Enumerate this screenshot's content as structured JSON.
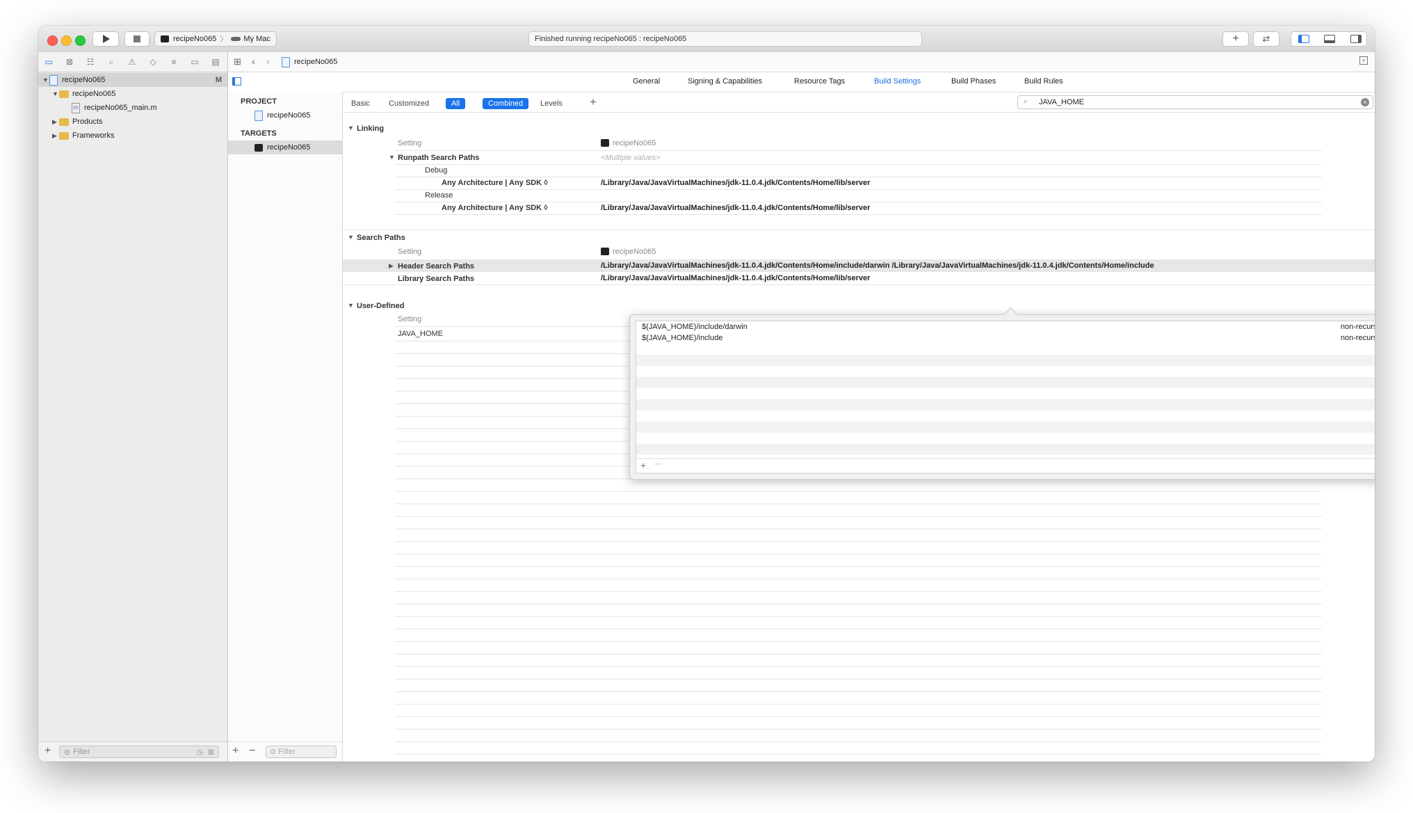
{
  "window": {
    "scheme_target": "recipeNo065",
    "destination": "My Mac",
    "status": "Finished running recipeNo065 : recipeNo065"
  },
  "navigator": {
    "badge": "M",
    "items": [
      {
        "label": "recipeNo065",
        "type": "project"
      },
      {
        "label": "recipeNo065",
        "type": "folder"
      },
      {
        "label": "recipeNo065_main.m",
        "type": "file"
      },
      {
        "label": "Products",
        "type": "folder"
      },
      {
        "label": "Frameworks",
        "type": "folder"
      }
    ],
    "filter_placeholder": "Filter"
  },
  "jumpbar": {
    "crumb": "recipeNo065"
  },
  "tabs": [
    "General",
    "Signing & Capabilities",
    "Resource Tags",
    "Build Settings",
    "Build Phases",
    "Build Rules"
  ],
  "active_tab": "Build Settings",
  "targets_pane": {
    "project_header": "PROJECT",
    "project_item": "recipeNo065",
    "targets_header": "TARGETS",
    "target_item": "recipeNo065",
    "filter_placeholder": "Filter"
  },
  "filterbar": {
    "basic": "Basic",
    "customized": "Customized",
    "all": "All",
    "combined": "Combined",
    "levels": "Levels",
    "search_value": "JAVA_HOME"
  },
  "sections": {
    "linking": {
      "title": "Linking",
      "setting_col": "Setting",
      "target_col": "recipeNo065",
      "runpath_label": "Runpath Search Paths",
      "runpath_value": "<Multiple values>",
      "debug_label": "Debug",
      "debug_arch": "Any Architecture | Any SDK ◊",
      "debug_value": "/Library/Java/JavaVirtualMachines/jdk-11.0.4.jdk/Contents/Home/lib/server",
      "release_label": "Release",
      "release_arch": "Any Architecture | Any SDK ◊",
      "release_value": "/Library/Java/JavaVirtualMachines/jdk-11.0.4.jdk/Contents/Home/lib/server"
    },
    "search_paths": {
      "title": "Search Paths",
      "setting_col": "Setting",
      "target_col": "recipeNo065",
      "header_label": "Header Search Paths",
      "header_value": "/Library/Java/JavaVirtualMachines/jdk-11.0.4.jdk/Contents/Home/include/darwin /Library/Java/JavaVirtualMachines/jdk-11.0.4.jdk/Contents/Home/include",
      "library_label": "Library Search Paths",
      "library_value": "/Library/Java/JavaVirtualMachines/jdk-11.0.4.jdk/Contents/Home/lib/server"
    },
    "user_defined": {
      "title": "User-Defined",
      "setting_col": "Setting",
      "java_home_label": "JAVA_HOME"
    }
  },
  "popover": {
    "rows": [
      {
        "path": "$(JAVA_HOME)/include/darwin",
        "mode": "non-recursive ◊"
      },
      {
        "path": "$(JAVA_HOME)/include",
        "mode": "non-recursive ◊"
      }
    ],
    "add": "+",
    "remove": "—"
  }
}
